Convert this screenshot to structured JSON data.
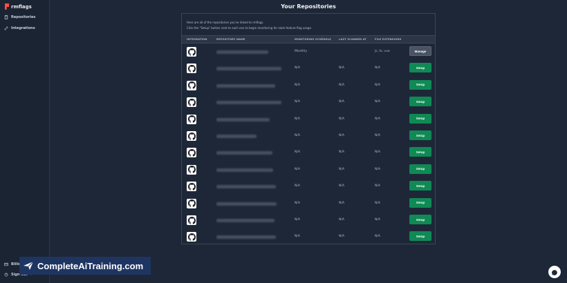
{
  "app": {
    "name": "rmflags",
    "brand_color": "#ff4d4d"
  },
  "sidebar": {
    "items": [
      {
        "label": "Repositories",
        "icon": "book-icon"
      },
      {
        "label": "Integrations",
        "icon": "link-icon"
      }
    ],
    "bottom": [
      {
        "label": "Billing",
        "icon": "card-icon"
      },
      {
        "label": "Sign out →",
        "icon": "logout-icon"
      }
    ]
  },
  "page": {
    "title": "Your Repositories",
    "intro_line1": "Here are all of the repositories you've linked to rmflags.",
    "intro_line2": "Click the \"Setup\" button next to each one to begin monitoring for stale feature flag usage."
  },
  "table": {
    "headers": [
      "INTEGRATION",
      "REPOSITORY NAME",
      "MONITORING SCHEDULE",
      "LAST SCANNED AT",
      "FILE EXTENSIONS"
    ],
    "rows": [
      {
        "integration": "github-icon",
        "schedule": "Monthly",
        "last_scanned": "",
        "extensions": "js, ts, vue",
        "action": "Manage"
      },
      {
        "integration": "github-icon",
        "schedule": "N/A",
        "last_scanned": "N/A",
        "extensions": "N/A",
        "action": "Setup"
      },
      {
        "integration": "github-icon",
        "schedule": "N/A",
        "last_scanned": "N/A",
        "extensions": "N/A",
        "action": "Setup"
      },
      {
        "integration": "github-icon",
        "schedule": "N/A",
        "last_scanned": "N/A",
        "extensions": "N/A",
        "action": "Setup"
      },
      {
        "integration": "github-icon",
        "schedule": "N/A",
        "last_scanned": "N/A",
        "extensions": "N/A",
        "action": "Setup"
      },
      {
        "integration": "github-icon",
        "schedule": "N/A",
        "last_scanned": "N/A",
        "extensions": "N/A",
        "action": "Setup"
      },
      {
        "integration": "github-icon",
        "schedule": "N/A",
        "last_scanned": "N/A",
        "extensions": "N/A",
        "action": "Setup"
      },
      {
        "integration": "github-icon",
        "schedule": "N/A",
        "last_scanned": "N/A",
        "extensions": "N/A",
        "action": "Setup"
      },
      {
        "integration": "github-icon",
        "schedule": "N/A",
        "last_scanned": "N/A",
        "extensions": "N/A",
        "action": "Setup"
      },
      {
        "integration": "github-icon",
        "schedule": "N/A",
        "last_scanned": "N/A",
        "extensions": "N/A",
        "action": "Setup"
      },
      {
        "integration": "github-icon",
        "schedule": "N/A",
        "last_scanned": "N/A",
        "extensions": "N/A",
        "action": "Setup"
      },
      {
        "integration": "github-icon",
        "schedule": "N/A",
        "last_scanned": "N/A",
        "extensions": "N/A",
        "action": "Setup"
      }
    ]
  },
  "watermark": {
    "text": "CompleteAiTraining.com"
  },
  "colors": {
    "setup_button": "#0f8a55",
    "manage_button": "#4a5363",
    "background": "#1e2737"
  }
}
